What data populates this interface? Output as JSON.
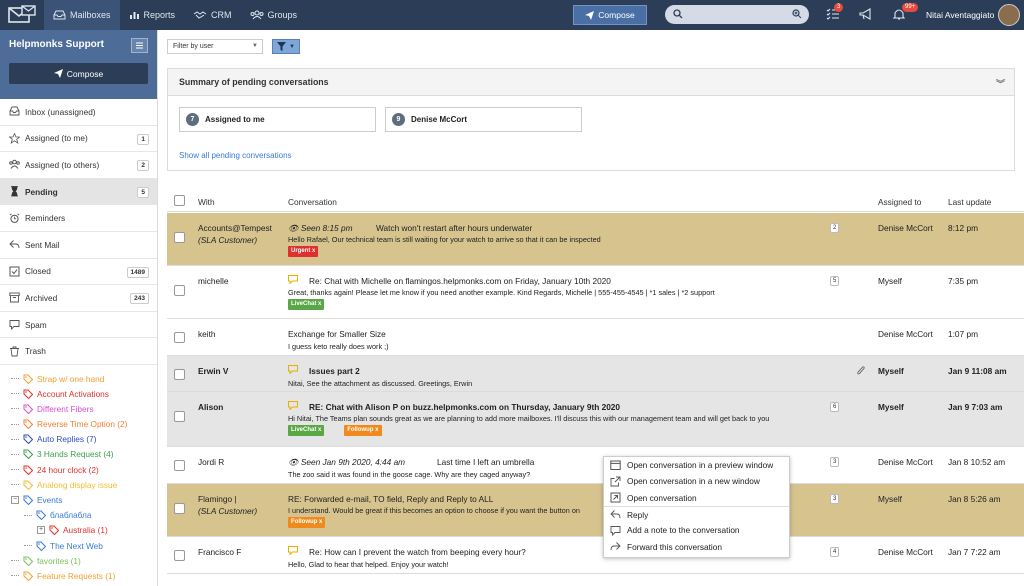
{
  "topbar": {
    "tabs": [
      {
        "label": "Mailboxes",
        "active": true,
        "icon": "inbox-icon"
      },
      {
        "label": "Reports",
        "icon": "bar-chart-icon"
      },
      {
        "label": "CRM",
        "icon": "handshake-icon"
      },
      {
        "label": "Groups",
        "icon": "users-icon"
      }
    ],
    "compose_label": "Compose",
    "tasks_badge": "3",
    "notif_badge": "99+",
    "user_name": "Nitai Aventaggiato",
    "colors": {
      "bar": "#2c3e57",
      "active": "#3a5377",
      "compose": "#4a6fa5"
    }
  },
  "sidebar": {
    "title": "Helpmonks Support",
    "compose_label": "Compose",
    "items": [
      {
        "label": "Inbox (unassigned)",
        "icon": "inbox-icon"
      },
      {
        "label": "Assigned (to me)",
        "icon": "star-icon",
        "count": "1"
      },
      {
        "label": "Assigned (to others)",
        "icon": "users-icon",
        "count": "2"
      },
      {
        "label": "Pending",
        "icon": "hourglass-icon",
        "count": "5",
        "active": true
      },
      {
        "label": "Reminders",
        "icon": "alarm-icon"
      },
      {
        "label": "Sent Mail",
        "icon": "reply-icon"
      },
      {
        "label": "Closed",
        "icon": "check-square-icon",
        "count": "1489"
      },
      {
        "label": "Archived",
        "icon": "archive-icon",
        "count": "243"
      },
      {
        "label": "Spam",
        "icon": "spam-icon"
      },
      {
        "label": "Trash",
        "icon": "trash-icon"
      }
    ],
    "tags": [
      {
        "label": "Strap w/ one hand",
        "color": "#f0a030"
      },
      {
        "label": "Account Activations",
        "color": "#e0302e"
      },
      {
        "label": "Different Fibers",
        "color": "#d94fd0"
      },
      {
        "label": "Reverse Time Option (2)",
        "color": "#f08030"
      },
      {
        "label": "Auto Replies (7)",
        "color": "#2a4fbf"
      },
      {
        "label": "3 Hands Request (4)",
        "color": "#3aa04a"
      },
      {
        "label": "24 hour clock (2)",
        "color": "#e0302e"
      },
      {
        "label": "Analong display issue",
        "color": "#f0c030"
      },
      {
        "label": "Events",
        "color": "#3a7bd5",
        "expander": "−"
      },
      {
        "label": "блаблабла",
        "color": "#3a7bd5",
        "indent": 1
      },
      {
        "label": "Australia (1)",
        "color": "#e0302e",
        "indent": 2,
        "expander": "+"
      },
      {
        "label": "The Next Web",
        "color": "#3a7bd5",
        "indent": 1
      },
      {
        "label": "favorites (1)",
        "color": "#7ac25a"
      },
      {
        "label": "Feature Requests (1)",
        "color": "#f0a030"
      }
    ]
  },
  "main": {
    "filter_placeholder": "Filter by user",
    "summary": {
      "title": "Summary of pending conversations",
      "cards": [
        {
          "num": "7",
          "label": "Assigned to me"
        },
        {
          "num": "9",
          "label": "Denise McCort"
        }
      ],
      "show_all": "Show all pending conversations"
    },
    "columns": {
      "with": "With",
      "conversation": "Conversation",
      "assigned": "Assigned to",
      "updated": "Last update"
    },
    "rows": [
      {
        "with": "Accounts@Tempest",
        "with2": "(SLA Customer)",
        "seen": "Seen 8:15 pm",
        "subject": "Watch won't restart after hours underwater",
        "preview": "Hello Rafael, Our technical team is still waiting for your watch to arrive so that it can be inspected",
        "count": "2",
        "assigned": "Denise McCort",
        "updated": "8:12 pm",
        "labels": [
          {
            "text": "Urgent  x",
            "color": "#e0302e"
          }
        ],
        "highlight": "#d6c38e"
      },
      {
        "with": "michelle",
        "subject": "Re: Chat with Michelle on flamingos.helpmonks.com on Friday, January 10th 2020",
        "preview": "Great, thanks again! Please let me know if you need another example. Kind Regards, Michelle | 555-455-4545 | *1 sales | *2 support",
        "count": "5",
        "assigned": "Myself",
        "updated": "7:35 pm",
        "labels": [
          {
            "text": "LiveChat  x",
            "color": "#5aa845"
          }
        ]
      },
      {
        "with": "keith",
        "subject": "Exchange for Smaller Size",
        "preview": "I guess keto really does work ;)",
        "assigned": "Denise McCort",
        "updated": "1:07 pm"
      },
      {
        "with": "Erwin V",
        "subject": "Issues part 2",
        "preview": "Nitai, See the attachment as discussed. Greetings, Erwin",
        "assigned": "Myself",
        "updated": "Jan 9 11:08 am",
        "highlight": "#e5e5e5",
        "bold": true
      },
      {
        "with": "Alison",
        "subject": "RE: Chat with Alison P on buzz.helpmonks.com on Thursday, January 9th 2020",
        "preview": "Hi Nitai, The Teams plan sounds great as we are planning to add more mailboxes. I'll discuss this with our management team and will get back to you",
        "count": "6",
        "assigned": "Myself",
        "updated": "Jan 9 7:03 am",
        "labels": [
          {
            "text": "LiveChat  x",
            "color": "#5aa845"
          },
          {
            "text": "Followup  x",
            "color": "#f08a1c"
          }
        ],
        "highlight": "#e5e5e5",
        "bold": true
      },
      {
        "with": "Jordi R",
        "seen": "Seen Jan 9th 2020, 4:44 am",
        "subject": "Last time I left an umbrella",
        "preview": "The zoo said it was found in the goose cage. Why are they caged anyway?",
        "count": "3",
        "assigned": "Denise McCort",
        "updated": "Jan 8 10:52 am"
      },
      {
        "with": "Flamingo |",
        "with2": "(SLA Customer)",
        "subject": "RE: Forwarded e-mail, TO field, Reply and Reply to ALL",
        "preview": "I understand. Would be great if this becomes an option to choose if you want the button on",
        "count": "3",
        "assigned": "Myself",
        "updated": "Jan 8 5:26 am",
        "labels": [
          {
            "text": "Followup  x",
            "color": "#f08a1c"
          }
        ],
        "highlight": "#d6c38e"
      },
      {
        "with": "Francisco F",
        "subject": "Re: How can I prevent the watch from beeping every hour?",
        "preview": "Hello, Glad to hear that helped. Enjoy your watch!",
        "count": "4",
        "assigned": "Denise McCort",
        "updated": "Jan 7 7:22 am"
      }
    ]
  },
  "context_menu": {
    "items": [
      {
        "label": "Open conversation in a preview window",
        "icon": "preview-window-icon"
      },
      {
        "label": "Open conversation in a new window",
        "icon": "external-link-icon"
      },
      {
        "label": "Open conversation",
        "icon": "open-icon"
      },
      {
        "label": "Reply",
        "icon": "reply-icon",
        "sep": true
      },
      {
        "label": "Add a note to the conversation",
        "icon": "comment-icon"
      },
      {
        "label": "Forward this conversation",
        "icon": "forward-icon"
      }
    ]
  }
}
